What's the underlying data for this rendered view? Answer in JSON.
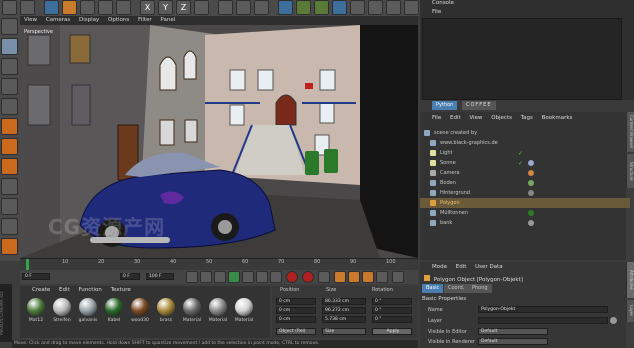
{
  "viewport": {
    "menu": [
      "View",
      "Cameras",
      "Display",
      "Options",
      "Filter",
      "Panel"
    ],
    "camera_label": "Perspective"
  },
  "console": {
    "title": "Console",
    "menu_item": "File"
  },
  "script_tabs": [
    "Python",
    "COFFEE"
  ],
  "object_manager": {
    "menu": [
      "File",
      "Edit",
      "View",
      "Objects",
      "Tags",
      "Bookmarks"
    ],
    "items": [
      {
        "label": "scene created by",
        "icon": "object-icon"
      },
      {
        "label": "www.black-graphics.de",
        "icon": "object-icon"
      },
      {
        "label": "Light",
        "icon": "light-icon"
      },
      {
        "label": "Sonne",
        "icon": "light-icon"
      },
      {
        "label": "Camera",
        "icon": "camera-icon"
      },
      {
        "label": "Boden",
        "icon": "object-icon"
      },
      {
        "label": "Hintergrund",
        "icon": "object-icon"
      },
      {
        "label": "Polygon",
        "icon": "polygon-icon"
      },
      {
        "label": "Mülltonnen",
        "icon": "object-icon"
      },
      {
        "label": "bank",
        "icon": "object-icon"
      }
    ]
  },
  "timeline": {
    "ticks": [
      "0",
      "10",
      "20",
      "30",
      "40",
      "50",
      "60",
      "70",
      "80",
      "90",
      "100"
    ],
    "frame_start": "0 F",
    "frame_end": "100 F",
    "current": "0 F"
  },
  "material_manager": {
    "menu": [
      "Create",
      "Edit",
      "Function",
      "Texture"
    ],
    "materials": [
      {
        "label": "Mat12",
        "color": "#4f7a3b"
      },
      {
        "label": "Streifen",
        "color": "#b9b9b9"
      },
      {
        "label": "galvanis",
        "color": "#9aa3a8"
      },
      {
        "label": "Kabel",
        "color": "#2a6a2a"
      },
      {
        "label": "wood30",
        "color": "#7a4a22"
      },
      {
        "label": "brass",
        "color": "#a88a3c"
      },
      {
        "label": "Material",
        "color": "#6b6b6b"
      },
      {
        "label": "Material",
        "color": "#8a8a8a"
      },
      {
        "label": "Material",
        "color": "#d0d0d0"
      }
    ]
  },
  "coordinates": {
    "headers": [
      "Position",
      "Size",
      "Rotation"
    ],
    "rows": [
      {
        "pos": "0 cm",
        "size": "80.333 cm",
        "rot": "0 °"
      },
      {
        "pos": "0 cm",
        "size": "96.272 cm",
        "rot": "0 °"
      },
      {
        "pos": "0 cm",
        "size": "5.738 cm",
        "rot": "0 °"
      }
    ],
    "mode_select": "Object (Rel)",
    "size_select": "Size",
    "apply_label": "Apply"
  },
  "attributes": {
    "menu": [
      "Mode",
      "Edit",
      "User Data"
    ],
    "title": "Polygon Object [Polygon-Objekt]",
    "tabs": [
      "Basic",
      "Coord.",
      "Phong"
    ],
    "section": "Basic Properties",
    "fields": [
      {
        "label": "Name",
        "value": "Polygon-Objekt"
      },
      {
        "label": "Layer",
        "value": ""
      },
      {
        "label": "Visible in Editor",
        "value": "Default"
      },
      {
        "label": "Visible in Renderer",
        "value": "Default"
      }
    ]
  },
  "side_tabs": [
    "Content Browser",
    "Structure",
    "Attributes",
    "Layer"
  ],
  "status": "Move: Click and drag to move elements. Hold down SHIFT to quantize movement / add to the selection in point mode, CTRL to remove.",
  "watermark": "CG资源产网",
  "brand": "MAXON CINEMA 4D"
}
